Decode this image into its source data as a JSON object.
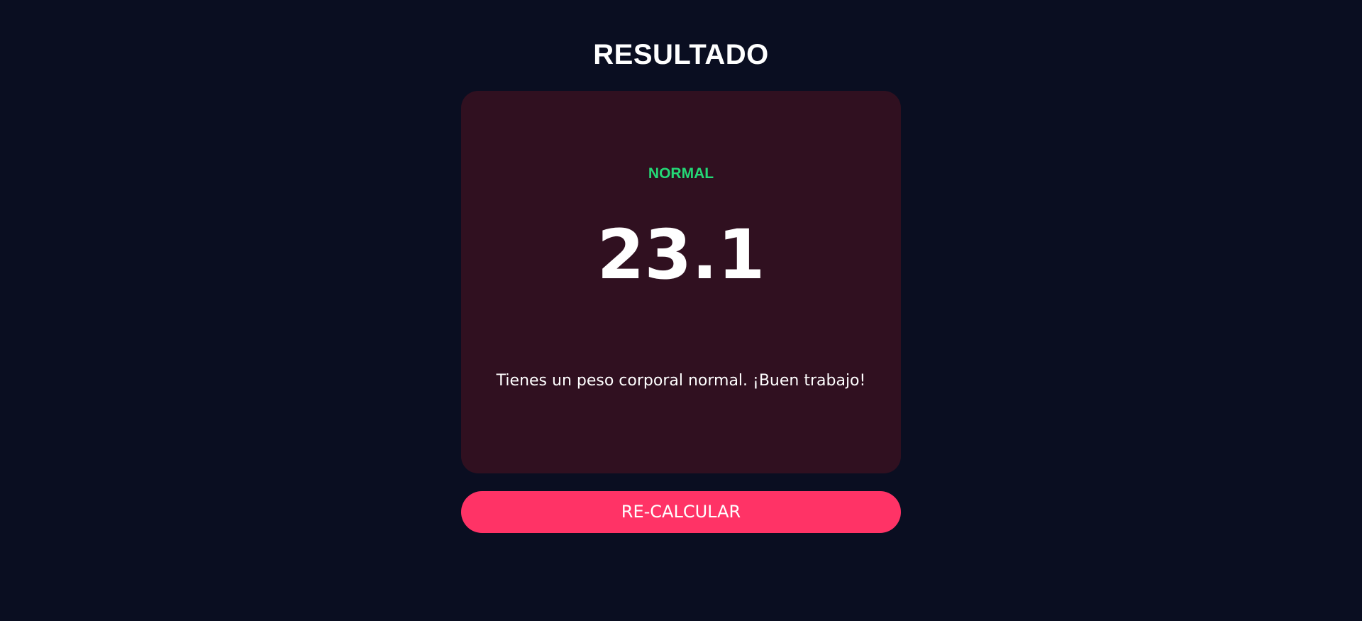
{
  "header": {
    "title": "RESULTADO"
  },
  "result": {
    "status": "NORMAL",
    "status_color": "#24d876",
    "bmi_value": "23.1",
    "message": "Tienes un peso corporal normal. ¡Buen trabajo!"
  },
  "actions": {
    "recalculate_label": "RE-CALCULAR"
  },
  "colors": {
    "background": "#0a0e21",
    "card": "#301020",
    "accent": "#ff3366"
  }
}
